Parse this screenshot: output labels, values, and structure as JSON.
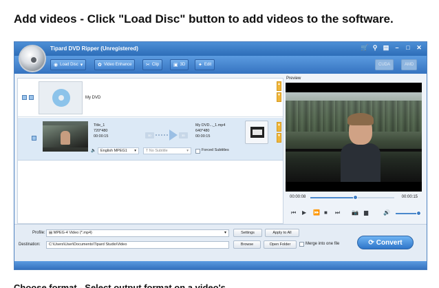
{
  "heading": "Add videos - Click \"Load Disc\" button to add videos to the software.",
  "clipped_text": "Choose format - Select output format on a video's",
  "window": {
    "title": "Tipard DVD Ripper (Unregistered)",
    "controls": [
      "cart-icon",
      "pin-icon",
      "minimize",
      "restore",
      "close"
    ]
  },
  "toolbar": {
    "load_disc": "Load Disc",
    "video_enhance": "Video Enhance",
    "clip": "Clip",
    "threed": "3D",
    "edit": "Edit",
    "cuda": "CUDA",
    "amd": "AMD"
  },
  "list": {
    "disc_name": "My DVD",
    "title": {
      "name": "Title_1",
      "resolution": "720*480",
      "duration": "00:00:15",
      "output_name": "My DVD..._1.mp4",
      "output_resolution": "640*480",
      "output_duration": "00:00:15",
      "audio": "English MPEG1",
      "subtitle": "No Subtitle",
      "forced_subtitles": "Forced Subtitles"
    }
  },
  "preview": {
    "label": "Preview",
    "time_current": "00:00:08",
    "time_total": "00:00:15",
    "progress": 0.53
  },
  "bottom": {
    "profile_label": "Profile:",
    "profile_value": "MPEG-4 Video (*.mp4)",
    "settings": "Settings",
    "apply_to_all": "Apply to All",
    "destination_label": "Destination:",
    "destination_value": "C:\\Users\\User\\Documents\\Tipard Studio\\Video",
    "browse": "Browse",
    "open_folder": "Open Folder",
    "merge": "Merge into one file",
    "convert": "Convert"
  }
}
